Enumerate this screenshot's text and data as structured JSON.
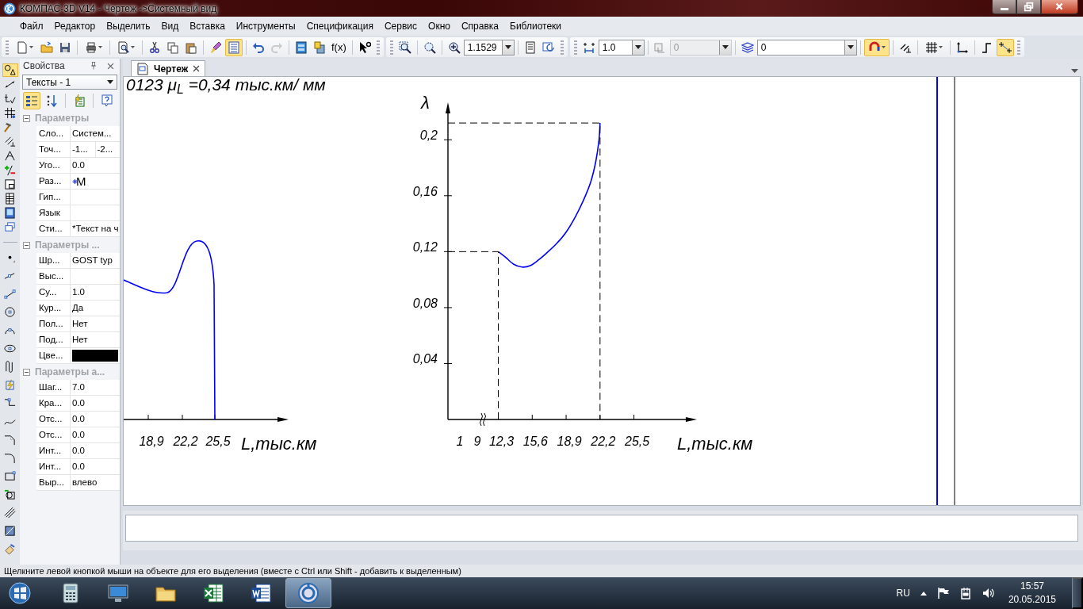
{
  "window": {
    "title": "КОМПАС-3D V14 - Чертеж ->Системный вид"
  },
  "menu": [
    "Файл",
    "Редактор",
    "Выделить",
    "Вид",
    "Вставка",
    "Инструменты",
    "Спецификация",
    "Сервис",
    "Окно",
    "Справка",
    "Библиотеки"
  ],
  "toolbar": {
    "properties_toggle": {
      "selected": true
    },
    "redo": {
      "disabled": true
    },
    "function_label": "f(x)",
    "zoom": "1.1529",
    "step": "1.0",
    "angle": {
      "value": "0",
      "disabled": true
    },
    "layer": "0",
    "snap_toggle": {
      "selected": true
    },
    "points_toggle": {
      "selected": true
    }
  },
  "tool_strip": [
    {
      "selected": true
    },
    {
      "selected": false
    },
    {
      "selected": false
    },
    {
      "selected": false
    },
    {
      "selected": false
    },
    {
      "selected": false
    },
    {
      "selected": false
    },
    {
      "selected": false
    },
    {
      "selected": false
    },
    {
      "selected": false
    },
    {
      "selected": false
    },
    {
      "selected": false
    },
    {
      "selected": false
    },
    {
      "selected": false
    },
    {
      "selected": false
    },
    {
      "selected": false
    },
    {
      "selected": false
    },
    {
      "selected": false
    },
    {
      "selected": false
    },
    {
      "selected": false
    },
    {
      "selected": false
    },
    {
      "selected": false
    },
    {
      "selected": false
    },
    {
      "selected": false
    },
    {
      "selected": false
    },
    {
      "selected": false
    },
    {
      "selected": false
    },
    {
      "selected": false
    },
    {
      "selected": false
    }
  ],
  "properties": {
    "title": "Свойства",
    "object": "Тексты - 1",
    "tools": [
      {
        "selected": true
      },
      {
        "selected": false
      },
      {
        "selected": false
      },
      {
        "selected": false
      }
    ],
    "groups": [
      {
        "title": "Параметры",
        "expanded": true,
        "rows": [
          {
            "label": "Сло...",
            "values": [
              "Систем..."
            ]
          },
          {
            "label": "Точ...",
            "values": [
              "-1...",
              "-2..."
            ]
          },
          {
            "label": "Уго...",
            "values": [
              "0.0"
            ]
          },
          {
            "label": "Раз...",
            "kind": "sample",
            "values": [
              "M"
            ]
          },
          {
            "label": "Гип..."
          },
          {
            "label": "Язык"
          },
          {
            "label": "Сти...",
            "values": [
              "*Текст на ч"
            ]
          }
        ]
      },
      {
        "title": "Параметры ...",
        "expanded": true,
        "rows": [
          {
            "label": "Шр...",
            "values": [
              "GOST typ"
            ]
          },
          {
            "label": "Выс..."
          },
          {
            "label": "Су...",
            "values": [
              "1.0"
            ]
          },
          {
            "label": "Кур...",
            "values": [
              "Да"
            ]
          },
          {
            "label": "Пол...",
            "values": [
              "Нет"
            ]
          },
          {
            "label": "Под...",
            "values": [
              "Нет"
            ]
          },
          {
            "label": "Цве...",
            "kind": "color",
            "color": "#000000"
          }
        ]
      },
      {
        "title": "Параметры а...",
        "expanded": true,
        "rows": [
          {
            "label": "Шаг...",
            "values": [
              "7.0"
            ]
          },
          {
            "label": "Кра...",
            "values": [
              "0.0"
            ]
          },
          {
            "label": "Отс...",
            "values": [
              "0.0"
            ]
          },
          {
            "label": "Отс...",
            "values": [
              "0.0"
            ]
          },
          {
            "label": "Инт...",
            "values": [
              "0.0"
            ]
          },
          {
            "label": "Инт...",
            "values": [
              "0.0"
            ]
          },
          {
            "label": "Выр...",
            "values": [
              "влево"
            ]
          }
        ]
      }
    ]
  },
  "document_tab": {
    "title": "Чертеж",
    "selected": true
  },
  "drawing": {
    "caption": "0123 μ$_{L}$ =0,34 тыс.км/ мм",
    "left_chart": {
      "x_labels": [
        "18,9",
        "22,2",
        "25,5"
      ],
      "x_axis_label": "L,тыс.км"
    },
    "chart": {
      "pre_break_labels": [
        "1",
        "9"
      ],
      "chart_data": {
        "type": "line",
        "xlabel": "L,тыс.км",
        "ylabel": "λ",
        "x": [
          12.3,
          13.0,
          13.8,
          14.6,
          15.4,
          16.2,
          17.0,
          18.0,
          18.9,
          19.8,
          20.6,
          21.3,
          21.8,
          22.1,
          22.2
        ],
        "series": [
          {
            "color": "#0000ff",
            "values": [
              0.12,
              0.116,
              0.111,
              0.109,
              0.11,
              0.114,
              0.119,
              0.126,
              0.134,
              0.145,
              0.157,
              0.17,
              0.185,
              0.2,
              0.212
            ]
          }
        ],
        "xlim": [
          7.4,
          30.7
        ],
        "ylim": [
          0,
          0.22
        ],
        "xticks": [
          {
            "value": 12.3,
            "label": "12,3"
          },
          {
            "value": 15.6,
            "label": "15,6"
          },
          {
            "value": 18.9,
            "label": "18,9"
          },
          {
            "value": 22.2,
            "label": "22,2"
          },
          {
            "value": 25.5,
            "label": "25,5"
          }
        ],
        "yticks": [
          {
            "value": 0.04,
            "label": "0,04"
          },
          {
            "value": 0.08,
            "label": "0,08"
          },
          {
            "value": 0.12,
            "label": "0,12"
          },
          {
            "value": 0.16,
            "label": "0,16"
          },
          {
            "value": 0.2,
            "label": "0,2"
          }
        ]
      }
    }
  },
  "status_bar": "Щелкните левой кнопкой мыши на объекте для его выделения (вместе с Ctrl или Shift - добавить к выделенным)",
  "taskbar": {
    "apps": [
      {
        "selected": false
      },
      {
        "selected": false
      },
      {
        "selected": false
      },
      {
        "selected": false
      },
      {
        "selected": false
      },
      {
        "selected": true
      }
    ],
    "language": "RU",
    "time": "15:57",
    "date": "20.05.2015"
  }
}
